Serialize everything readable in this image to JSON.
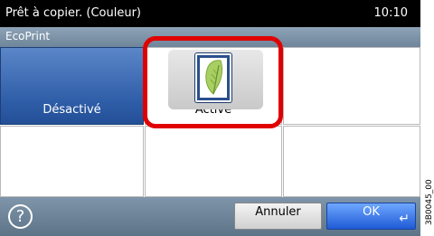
{
  "status": {
    "label": "Prêt à copier. (Couleur)",
    "time": "10:10"
  },
  "title": "EcoPrint",
  "options": [
    {
      "label": "Désactivé",
      "selected": false
    },
    {
      "label": "Activé",
      "selected": true,
      "icon": "leaf-icon"
    }
  ],
  "footer": {
    "help_symbol": "?",
    "cancel_label": "Annuler",
    "ok_label": "OK",
    "ok_symbol": "↵"
  },
  "side_code": "3B0045_00",
  "colors": {
    "selected_blue": "#2f5ea8",
    "highlight_red": "#e00000",
    "ok_blue": "#1f5bd6"
  }
}
